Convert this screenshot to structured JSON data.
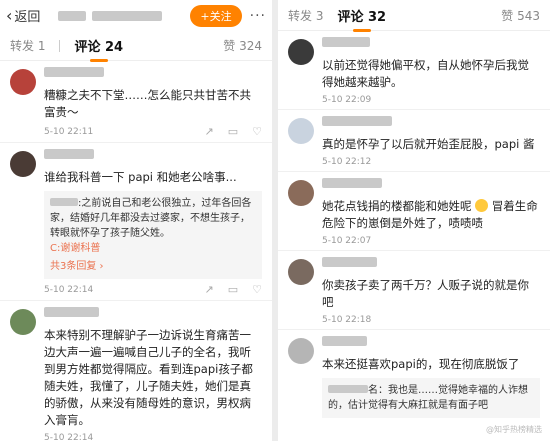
{
  "left": {
    "back_label": "返回",
    "follow_label": "+关注",
    "more": "···",
    "tabs": {
      "reposts": "转发 1",
      "comments": "评论 24",
      "likes": "赞 324"
    },
    "comments": [
      {
        "text": "糟糠之夫不下堂……怎么能只共甘苦不共富贵～",
        "time": "5-10 22:11"
      },
      {
        "text": "谁给我科普一下 papi 和她老公啥事...",
        "time": "5-10 22:14",
        "reply": {
          "lines": [
            ":之前说自己和老公很独立，过年各回各家，结婚好几年都没去过婆家，不想生孩子，转眼就怀孕了孩子随父姓。"
          ],
          "handle": "C:谢谢科普",
          "count": "共3条回复 ›"
        }
      },
      {
        "text": "本来特别不理解驴子一边诉说生育痛苦一边大声一遍一遍喊自己儿子的全名，我听到男方姓都觉得隔应。看到连papi孩子都随夫姓，我懂了，儿子随夫姓，她们是真的骄傲，从来没有随母姓的意识，男权病入膏肓。",
        "time": "5-10 22:14"
      }
    ]
  },
  "right": {
    "tabs": {
      "reposts": "转发 3",
      "comments": "评论 32",
      "likes": "赞 543"
    },
    "comments": [
      {
        "text": "以前还觉得她偏平权，自从她怀孕后我觉得她越来越驴。",
        "time": "5-10 22:09"
      },
      {
        "text": "真的是怀孕了以后就开始歪屁股，papi 酱",
        "time": "5-10 22:12"
      },
      {
        "text_before": "她花点钱捐的楼都能和她姓呢",
        "text_after": "冒着生命危险下的崽倒是外姓了，啧啧啧",
        "time": "5-10 22:07"
      },
      {
        "text": "你卖孩子卖了两千万？人贩子说的就是你吧",
        "time": "5-10 22:18"
      },
      {
        "text": "本来还挺喜欢papi的，现在彻底脱饭了",
        "time": "",
        "reply": {
          "lines": [
            "名：我也是……觉得她幸福的人诈想的，估计觉得有大麻扛就是有面子吧"
          ]
        }
      }
    ],
    "watermark": "@知乎热榜精选"
  },
  "colors": {
    "accent": "#ff8200",
    "link": "#eb7350"
  },
  "icons": [
    "chevron-left-icon",
    "more-icon",
    "share-icon",
    "comment-icon",
    "like-icon"
  ]
}
